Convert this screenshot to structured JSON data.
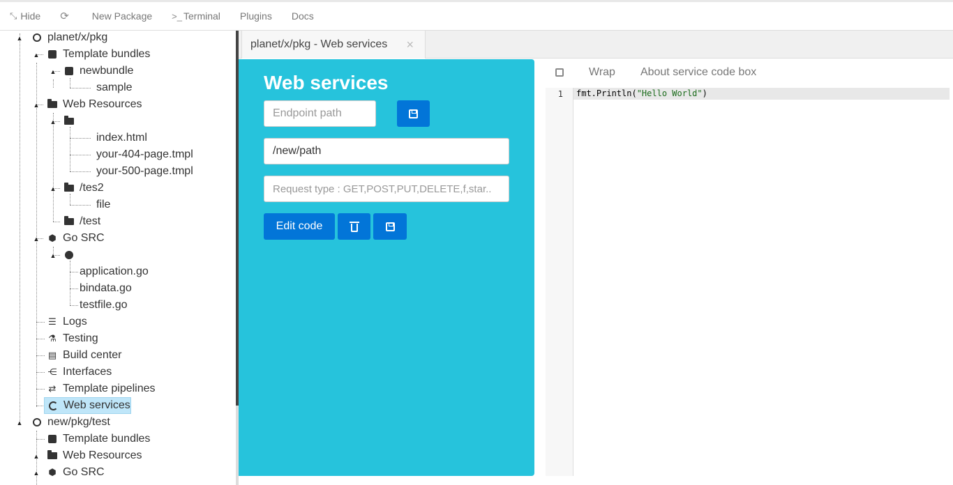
{
  "topbar": {
    "items": [
      {
        "label": "Hide",
        "icon": "compress-icon"
      },
      {
        "label": "",
        "icon": "refresh-icon"
      },
      {
        "label": "New Package",
        "icon": ""
      },
      {
        "label": "Terminal",
        "icon": "terminal-icon",
        "prefix": ">_"
      },
      {
        "label": "Plugins",
        "icon": ""
      },
      {
        "label": "Docs",
        "icon": ""
      }
    ]
  },
  "tree": {
    "nodes": [
      {
        "label": "planet/x/pkg"
      },
      {
        "label": "Template bundles"
      },
      {
        "label": "newbundle"
      },
      {
        "label": "sample"
      },
      {
        "label": "Web Resources"
      },
      {
        "label": ""
      },
      {
        "label": "index.html"
      },
      {
        "label": "your-404-page.tmpl"
      },
      {
        "label": "your-500-page.tmpl"
      },
      {
        "label": "/tes2"
      },
      {
        "label": "file"
      },
      {
        "label": "/test"
      },
      {
        "label": "Go SRC"
      },
      {
        "label": ""
      },
      {
        "label": "application.go"
      },
      {
        "label": "bindata.go"
      },
      {
        "label": "testfile.go"
      },
      {
        "label": "Logs"
      },
      {
        "label": "Testing"
      },
      {
        "label": "Build center"
      },
      {
        "label": "Interfaces"
      },
      {
        "label": "Template pipelines"
      },
      {
        "label": "Web services"
      },
      {
        "label": "new/pkg/test"
      },
      {
        "label": "Template bundles"
      },
      {
        "label": "Web Resources"
      },
      {
        "label": "Go SRC"
      }
    ]
  },
  "tab": {
    "label": "planet/x/pkg - Web services",
    "close": "×"
  },
  "webservices": {
    "title": "Web services",
    "endpoint_placeholder": "Endpoint path",
    "path_value": "/new/path",
    "request_type_placeholder": "Request type : GET,POST,PUT,DELETE,f,star..",
    "edit_code_label": "Edit code"
  },
  "editor": {
    "wrap_label": "Wrap",
    "about_label": "About service code box",
    "line_number": "1",
    "code_prefix": "fmt.Println(",
    "code_string": "\"Hello World\"",
    "code_suffix": ")"
  }
}
